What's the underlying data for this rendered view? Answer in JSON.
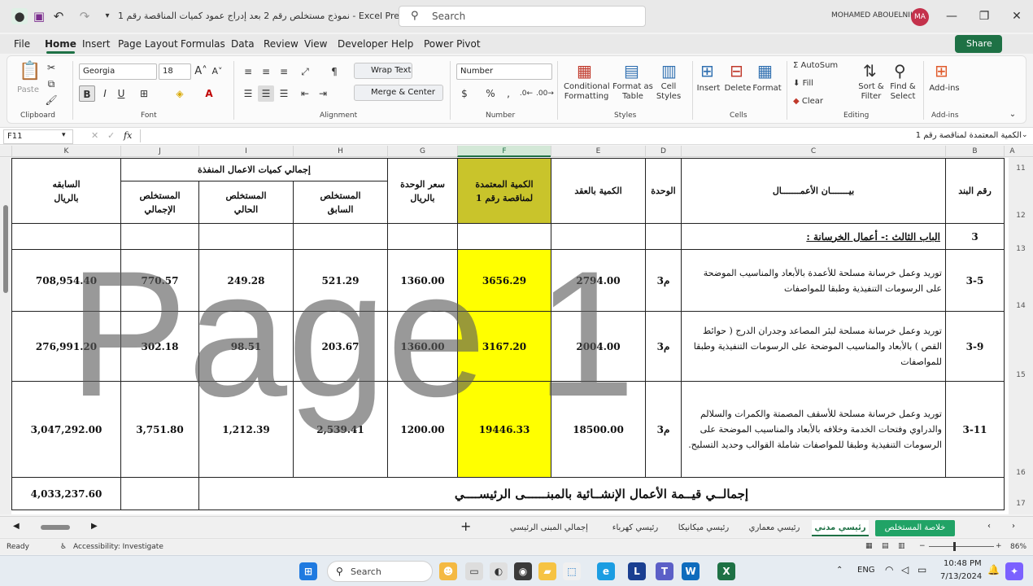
{
  "window": {
    "doc_title": "نموذج مستخلص رقم 2 بعد إدراج عمود كميات المناقصة رقم 1  -  Excel Preview",
    "search_label": "Search",
    "user_name": "MOHAMED ABOUELNIL",
    "user_initials": "MA"
  },
  "menu": {
    "tabs": [
      "File",
      "Home",
      "Insert",
      "Page Layout",
      "Formulas",
      "Data",
      "Review",
      "View",
      "Developer",
      "Help",
      "Power Pivot"
    ],
    "share_label": "Share"
  },
  "ribbon": {
    "clipboard": {
      "label": "Clipboard",
      "paste": "Paste"
    },
    "font": {
      "label": "Font",
      "name": "Georgia",
      "size": "18"
    },
    "alignment": {
      "label": "Alignment",
      "wrap_text": "Wrap Text",
      "merge_center": "Merge & Center"
    },
    "number": {
      "label": "Number",
      "format": "Number"
    },
    "styles": {
      "label": "Styles",
      "conditional_1": "Conditional",
      "conditional_2": "Formatting",
      "format_table_1": "Format as",
      "format_table_2": "Table",
      "cell_styles_1": "Cell",
      "cell_styles_2": "Styles"
    },
    "cells": {
      "label": "Cells",
      "insert": "Insert",
      "delete": "Delete",
      "format": "Format"
    },
    "editing": {
      "label": "Editing",
      "autosum": "AutoSum",
      "fill": "Fill",
      "clear": "Clear",
      "sort_1": "Sort &",
      "sort_2": "Filter",
      "find_1": "Find &",
      "find_2": "Select"
    },
    "addins": {
      "label": "Add-ins",
      "button": "Add-ins"
    }
  },
  "formula_bar": {
    "name_box": "F11",
    "fx": "fx",
    "content": "الكمية المعتمدة لمناقصة رقم 1"
  },
  "columns": [
    "K",
    "J",
    "I",
    "H",
    "G",
    "F",
    "E",
    "D",
    "C",
    "B",
    "A"
  ],
  "rows": [
    "11",
    "12",
    "13",
    "14",
    "15",
    "16",
    "17"
  ],
  "table": {
    "header": {
      "group_executed": "إجمالي كميات الاعمال المنفذة",
      "prev_value_1": "السابقه",
      "prev_value_2": "بالريال",
      "total_ext_1": "المستخلص",
      "total_ext_2": "الإجمالي",
      "current_ext_1": "المستخلص",
      "current_ext_2": "الحالي",
      "previous_ext_1": "المستخلص",
      "previous_ext_2": "السابق",
      "unit_price_1": "سعر الوحدة",
      "unit_price_2": "بالريال",
      "approved_1": "الكمية المعتمدة",
      "approved_2": "لمناقصة رقم 1",
      "contract_qty": "الكمية بالعقد",
      "unit": "الوحدة",
      "description": "بيـــــــان الأعمـــــــال",
      "item_no": "رقم البند"
    },
    "section": {
      "number": "3",
      "title": "الباب الثالث :-  أعمال الخرسانة :"
    },
    "items": [
      {
        "no": "3-5",
        "description": "توريد وعمل خرسانة مسلحة للأعمدة بالأبعاد والمناسيب الموضحة على الرسومات التنفيذية وطبقا للمواصفات",
        "unit": "م3",
        "contract_qty": "2794.00",
        "approved_qty": "3656.29",
        "unit_price": "1360.00",
        "prev": "521.29",
        "current": "249.28",
        "total": "770.57",
        "prev_value": "708,954.40"
      },
      {
        "no": "3-9",
        "description": "توريد وعمل خرسانة مسلحة  لبئر المصاعد وجدران الدرج ( حوائط القص ) بالأبعاد والمناسيب الموضحة على الرسومات التنفيذية وطبقا للمواصفات",
        "unit": "م3",
        "contract_qty": "2004.00",
        "approved_qty": "3167.20",
        "unit_price": "1360.00",
        "prev": "203.67",
        "current": "98.51",
        "total": "302.18",
        "prev_value": "276,991.20"
      },
      {
        "no": "3-11",
        "description": "توريد وعمل خرسانة مسلحة للأسقف المصمتة والكمرات والسلالم والدراوي وفتحات الخدمة وخلافه بالأبعاد والمناسيب الموضحة على الرسومات التنفيذية وطبقا للمواصفات شاملة القوالب وحديد التسليح.",
        "unit": "م3",
        "contract_qty": "18500.00",
        "approved_qty": "19446.33",
        "unit_price": "1200.00",
        "prev": "2,539.41",
        "current": "1,212.39",
        "total": "3,751.80",
        "prev_value": "3,047,292.00"
      }
    ],
    "total_label": "إجمالــي قيــمة الأعمال الإنشــائية بالمبنــــــى الرئيســــي",
    "total_value": "4,033,237.60"
  },
  "watermark": "Page 1",
  "sheet_tabs": [
    "خلاصة المستخلص",
    "رئيسي مدني",
    "رئيسي معماري",
    "رئيسي ميكانيكا",
    "رئيسي كهرباء",
    "إجمالي المبنى الرئيسي"
  ],
  "status": {
    "ready": "Ready",
    "accessibility": "Accessibility: Investigate",
    "zoom": "86%"
  },
  "taskbar": {
    "search": "Search",
    "lang": "ENG",
    "time": "10:48 PM",
    "date": "7/13/2024"
  },
  "colors": {
    "excel_green": "#1e7145",
    "highlight_yellow": "#ffff00",
    "selected_header": "#c9c42b"
  }
}
